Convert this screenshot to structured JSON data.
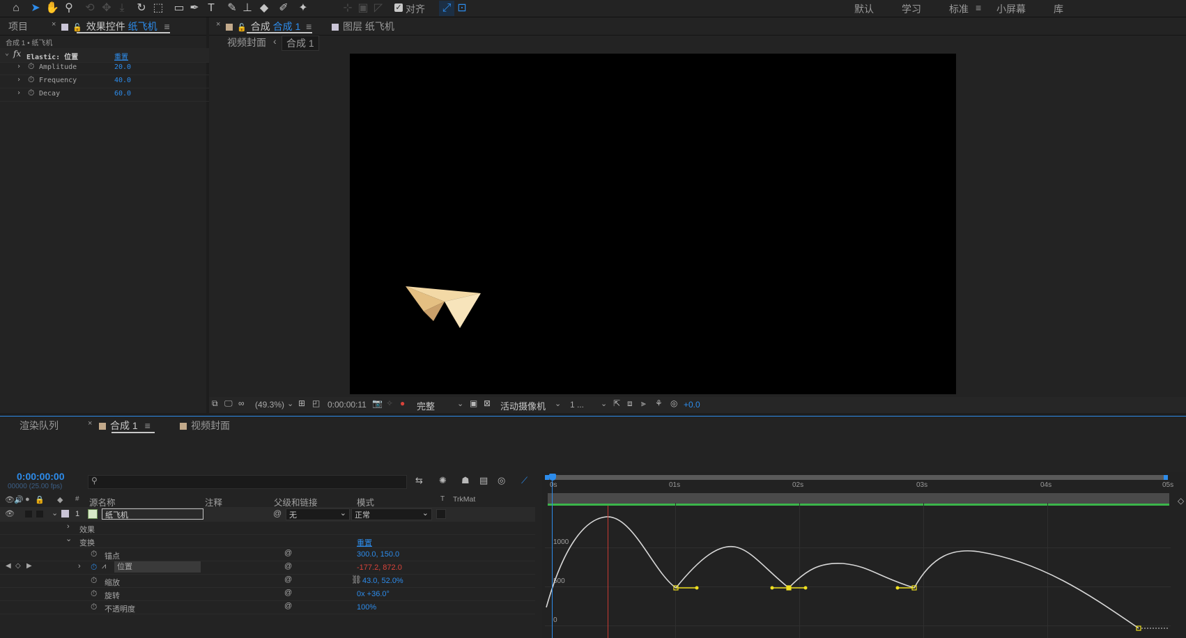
{
  "toolbar": {
    "snap_label": "对齐",
    "workspaces": [
      "默认",
      "学习",
      "标准",
      "小屏幕",
      "库"
    ],
    "active_workspace": "标准"
  },
  "project_tab": "项目",
  "effect_controls": {
    "tab_label": "效果控件",
    "tab_layer": "纸飞机",
    "breadcrumb": "合成 1 • 纸飞机",
    "effect_name": "Elastic: 位置",
    "reset_label": "重置",
    "params": [
      {
        "name": "Amplitude",
        "value": "20.0"
      },
      {
        "name": "Frequency",
        "value": "40.0"
      },
      {
        "name": "Decay",
        "value": "60.0"
      }
    ]
  },
  "viewer": {
    "comp_tab_prefix": "合成",
    "comp_tab_name": "合成 1",
    "layer_tab": "图层 纸飞机",
    "flow_parent": "视频封面",
    "flow_current": "合成 1",
    "zoom": "(49.3%)",
    "timecode": "0:00:00:11",
    "resolution": "完整",
    "camera": "活动摄像机",
    "views": "1 ...",
    "exposure": "+0.0"
  },
  "timeline": {
    "tabs": [
      "渲染队列",
      "合成 1",
      "视频封面"
    ],
    "current_time": "0:00:00:00",
    "frame_info": "00000 (25.00 fps)",
    "search_placeholder": "",
    "columns": {
      "num": "#",
      "source_name": "源名称",
      "comment": "注释",
      "parent": "父级和链接",
      "mode": "模式",
      "trkmat_t": "T",
      "trkmat": "TrkMat"
    },
    "layer": {
      "index": "1",
      "name": "纸飞机",
      "parent": "无",
      "mode": "正常"
    },
    "groups": {
      "effects": "效果",
      "transform": "变换",
      "reset": "重置"
    },
    "properties": [
      {
        "name": "锚点",
        "value": "300.0, 150.0",
        "color": "#2d8ceb"
      },
      {
        "name": "位置",
        "value": "-177.2, 872.0",
        "color": "#d9433a"
      },
      {
        "name": "缩放",
        "value": "43.0, 52.0%",
        "color": "#2d8ceb"
      },
      {
        "name": "旋转",
        "value": "0x +36.0°",
        "color": "#2d8ceb"
      },
      {
        "name": "不透明度",
        "value": "100%",
        "color": "#2d8ceb"
      }
    ],
    "ruler_labels": [
      "0s",
      "01s",
      "02s",
      "03s",
      "04s",
      "05s"
    ],
    "graph_labels": [
      "1000",
      "500",
      "0"
    ]
  }
}
